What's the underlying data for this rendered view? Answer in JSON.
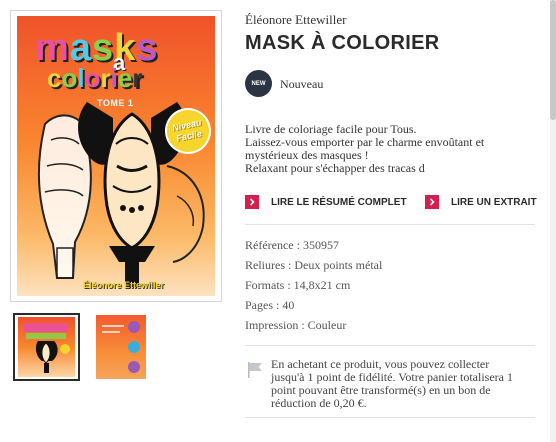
{
  "product": {
    "author": "Éléonore Ettewiller",
    "title": "MASK À COLORIER",
    "badge": {
      "short": "NEW",
      "label": "Nouveau"
    },
    "description": [
      "Livre de coloriage facile pour Tous.",
      "Laissez-vous emporter par le charme envoûtant et",
      "mystérieux des masques !",
      "Relaxant pour s'échapper des tracas d"
    ],
    "links": [
      {
        "label": "LIRE LE RÉSUMÉ COMPLET",
        "icon": "chevron-right-icon"
      },
      {
        "label": "LIRE UN EXTRAIT",
        "icon": "chevron-right-icon"
      }
    ],
    "specs": [
      "Référence : 350957",
      "Reliures : Deux points métal",
      "Formats : 14,8x21 cm",
      "Pages : 40",
      "Impression : Couleur"
    ],
    "loyalty": {
      "icon": "flag-icon",
      "lines": [
        "En achetant ce produit, vous pouvez collecter",
        "jusqu'à 1 point de fidélité. Votre panier totalisera 1",
        "point pouvant être transformé(s) en un bon de",
        "réduction de 0,20 €."
      ]
    }
  },
  "cover": {
    "title_word_1": "masks",
    "title_word_a": "a",
    "title_word_2": "colorier",
    "tome": "TOME 1",
    "badge_line_1": "Niveau",
    "badge_line_2": "Facile",
    "author": "Éléonore Ettewiller"
  },
  "thumbnails": [
    {
      "name": "front-cover",
      "selected": true
    },
    {
      "name": "back-cover",
      "selected": false
    }
  ],
  "colors": {
    "accent": "#d71d4e",
    "badge_bg": "#2c3443",
    "cover_orange": "#f9862e"
  }
}
